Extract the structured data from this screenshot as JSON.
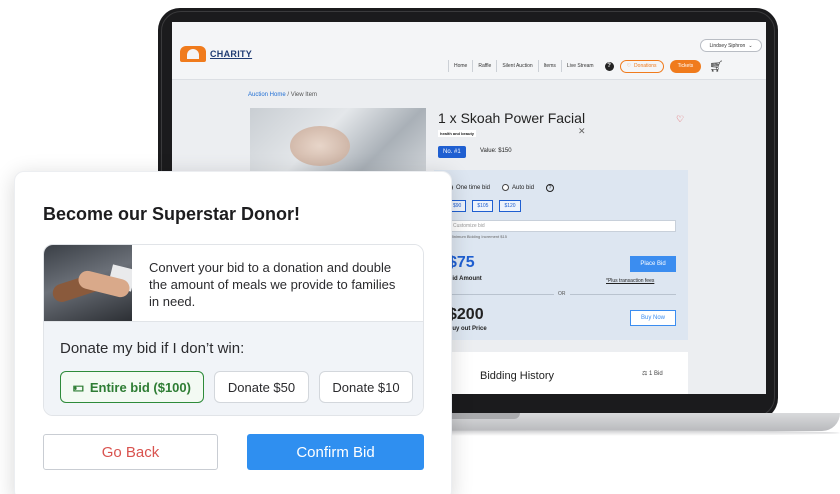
{
  "site": {
    "logo_text": "CHARITY",
    "user_name": "Lindsey Siphron",
    "nav": [
      "Home",
      "Raffle",
      "Silent Auction",
      "Items",
      "Live Stream"
    ],
    "donations_label": "Donations",
    "tickets_label": "Tickets",
    "accent_color": "#f07b1d"
  },
  "breadcrumb": {
    "home": "Auction Home",
    "separator": "/",
    "current": "View Item"
  },
  "item": {
    "title": "1 x Skoah Power Facial",
    "tag": "health and beauty",
    "number": "No. #1",
    "value": "Value: $150"
  },
  "bid": {
    "one_time": "One time bid",
    "auto": "Auto bid",
    "amounts": [
      "$90",
      "$105",
      "$120"
    ],
    "custom_placeholder": "Customize bid",
    "min_increment": "*Minimum Bidding Increment $15",
    "amount_display": "$75",
    "amount_label": "Bid Amount",
    "place_bid": "Place Bid",
    "plus_fees": "*Plus transaction fees",
    "or": "OR",
    "buyout_display": "$200",
    "buyout_label": "Buy out Price",
    "buy_now": "Buy Now"
  },
  "history": {
    "title": "Bidding History",
    "count": "1 Bid"
  },
  "modal": {
    "title": "Become our Superstar Donor!",
    "promo_text": "Convert your bid to a donation and double the amount of meals we provide to families in need.",
    "donate_label": "Donate my bid if I don’t win:",
    "options": [
      "Entire bid ($100)",
      "Donate $50",
      "Donate $10"
    ],
    "selected_option": "Entire bid ($100)",
    "go_back": "Go Back",
    "confirm": "Confirm Bid",
    "confirm_color": "#2f8ff0",
    "selected_color": "#2e8b3a"
  }
}
